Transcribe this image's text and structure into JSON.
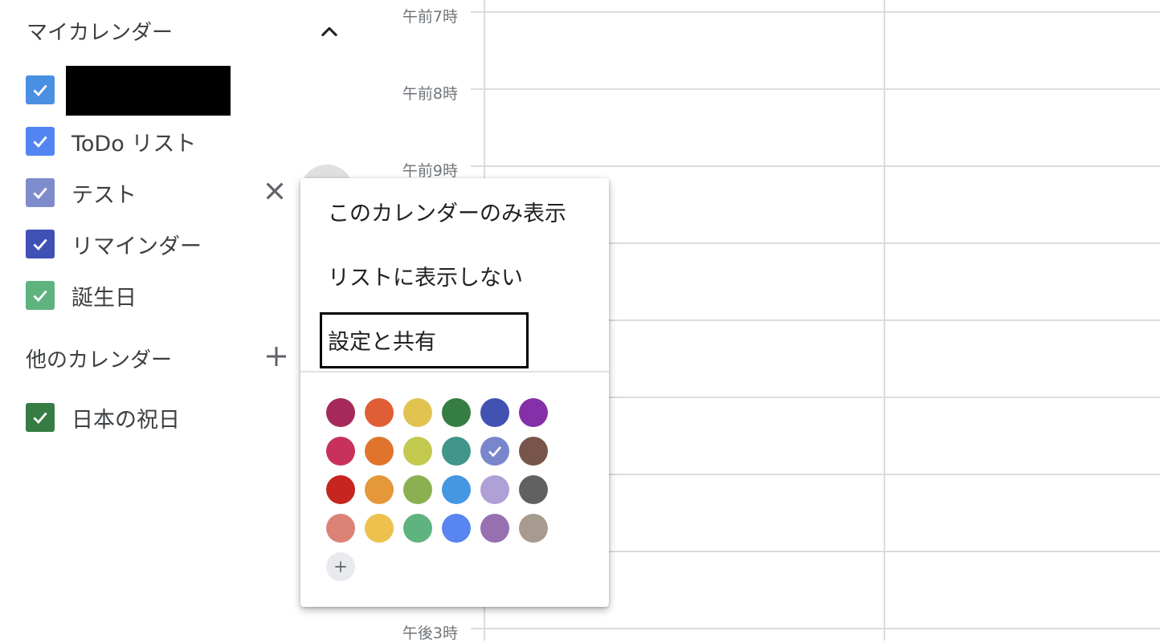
{
  "sidebar": {
    "my_calendars_title": "マイカレンダー",
    "other_calendars_title": "他のカレンダー",
    "my_calendars": [
      {
        "label": "",
        "color": "#4a90e2",
        "redacted": true
      },
      {
        "label": "ToDo リスト",
        "color": "#5385f2"
      },
      {
        "label": "テスト",
        "color": "#7f8ccc"
      },
      {
        "label": "リマインダー",
        "color": "#3f51b5"
      },
      {
        "label": "誕生日",
        "color": "#5fb37e"
      }
    ],
    "other_calendars": [
      {
        "label": "日本の祝日",
        "color": "#367d43"
      }
    ],
    "icons": {
      "collapse": "chevron-up-icon",
      "remove": "close-icon",
      "add": "plus-icon",
      "check": "check-icon"
    }
  },
  "grid": {
    "time_labels": [
      "午前7時",
      "午前8時",
      "午前9時",
      "午後3時"
    ]
  },
  "menu": {
    "items": [
      {
        "label": "このカレンダーのみ表示"
      },
      {
        "label": "リストに表示しない"
      },
      {
        "label": "設定と共有",
        "focused": true
      }
    ],
    "selected_color": "#7986cb",
    "colors": [
      [
        "#a52a59",
        "#e05e36",
        "#e2c352",
        "#367d43",
        "#4252b2",
        "#8430a8"
      ],
      [
        "#c8315e",
        "#e0742c",
        "#c3c94e",
        "#41958a",
        "#7986cb",
        "#77554a"
      ],
      [
        "#c6261f",
        "#e4983a",
        "#8ab051",
        "#4697e2",
        "#b0a0d8",
        "#616161"
      ],
      [
        "#dc8378",
        "#eec04e",
        "#5fb37e",
        "#5885ef",
        "#9670b0",
        "#a79b8f"
      ]
    ],
    "add_color_icon": "plus-icon"
  }
}
